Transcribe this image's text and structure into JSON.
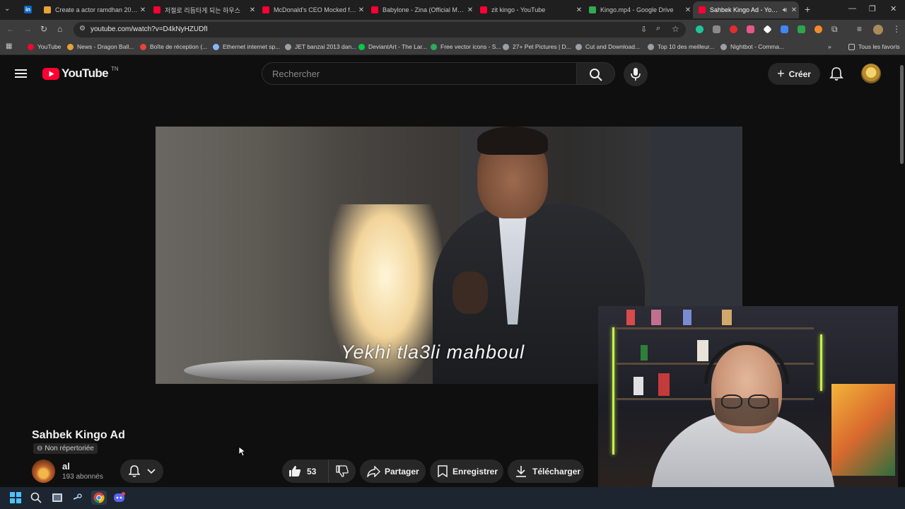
{
  "browser": {
    "tabs": [
      {
        "title": "Create a actor ramdhan 2026",
        "color": "#e8a23a"
      },
      {
        "title": "저절로 리듬타게 되는 하우스",
        "color": "#ff0033"
      },
      {
        "title": "McDonald's CEO Mocked for B",
        "color": "#ff0033"
      },
      {
        "title": "Babylone - Zina (Official Musi",
        "color": "#ff0033"
      },
      {
        "title": "zit kingo - YouTube",
        "color": "#ff0033"
      },
      {
        "title": "Kingo.mp4 - Google Drive",
        "color": "#34a853"
      },
      {
        "title": "Sahbek Kingo Ad - YouTu",
        "color": "#ff0033"
      }
    ],
    "url": "youtube.com/watch?v=D4kNyHZUDfI",
    "bookmarks": [
      {
        "label": "YouTube",
        "color": "#ff0033"
      },
      {
        "label": "News - Dragon Ball...",
        "color": "#e8a23a"
      },
      {
        "label": "Boîte de réception (...",
        "color": "#ea4335"
      },
      {
        "label": "Ethernet internet sp...",
        "color": "#8ab4f8"
      },
      {
        "label": "JET banzai 2013 dan...",
        "color": "#9aa0a6"
      },
      {
        "label": "DeviantArt - The Lar...",
        "color": "#05cc47"
      },
      {
        "label": "Free vector icons - S...",
        "color": "#27ae60"
      },
      {
        "label": "27+ Pet Pictures | D...",
        "color": "#9aa0a6"
      },
      {
        "label": "Cut and Download...",
        "color": "#9aa0a6"
      },
      {
        "label": "Top 10 des meilleur...",
        "color": "#9aa0a6"
      },
      {
        "label": "Nightbot - Comma...",
        "color": "#9aa0a6"
      }
    ],
    "all_bookmarks": "Tous les favoris"
  },
  "youtube": {
    "logo": "YouTube",
    "country": "TN",
    "search_placeholder": "Rechercher",
    "create_label": "Créer",
    "subtitle": "Yekhi tla3li mahboul",
    "video_title": "Sahbek Kingo Ad",
    "visibility": "Non répertoriée",
    "channel_name": "al",
    "subscribers": "193 abonnés",
    "likes": "53",
    "share_label": "Partager",
    "save_label": "Enregistrer",
    "download_label": "Télécharger"
  },
  "colors": {
    "bg": "#0f0f0f",
    "chip": "#272727",
    "brand_red": "#ff0033"
  }
}
